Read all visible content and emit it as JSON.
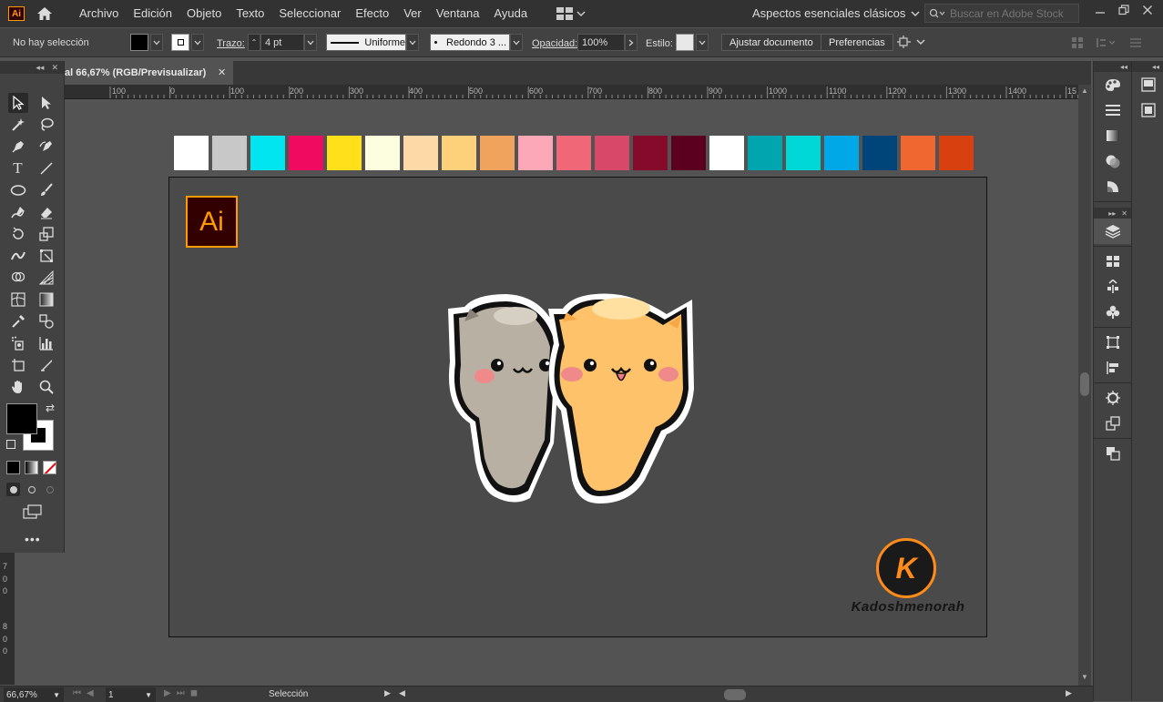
{
  "app": {
    "logo": "Ai"
  },
  "menu": [
    "Archivo",
    "Edición",
    "Objeto",
    "Texto",
    "Seleccionar",
    "Efecto",
    "Ver",
    "Ventana",
    "Ayuda"
  ],
  "workspace": "Aspectos esenciales clásicos",
  "stock_search": {
    "placeholder": "Buscar en Adobe Stock"
  },
  "control": {
    "selection": "No hay selección",
    "stroke_label": "Trazo:",
    "stroke_value": "4 pt",
    "profile": "Uniforme",
    "brush": "Redondo 3 ...",
    "opacity_label": "Opacidad:",
    "opacity_value": "100%",
    "style_label": "Estilo:",
    "fit_doc_button": "Ajustar documento",
    "preferences_button": "Preferencias"
  },
  "document": {
    "tab_title": "al 66,67% (RGB/Previsualizar)"
  },
  "ruler": [
    "100",
    "0",
    "100",
    "200",
    "300",
    "400",
    "500",
    "600",
    "700",
    "800",
    "900",
    "1000",
    "1100",
    "1200",
    "1300",
    "1400",
    "15"
  ],
  "vruler": [
    "7",
    "0",
    "0",
    "8",
    "0",
    "0"
  ],
  "swatch_colors": [
    "#ffffff",
    "#c8c8c8",
    "#00e5f0",
    "#f00a60",
    "#ffe01a",
    "#fdfde0",
    "#fdd9a8",
    "#fdd07a",
    "#f0a35c",
    "#fca8b8",
    "#f06878",
    "#d84868",
    "#860a2c",
    "#5c0020",
    "#ffffff",
    "#00a5b0",
    "#00d8d8",
    "#00a8e8",
    "#00457a",
    "#f06830",
    "#d84010"
  ],
  "artboard": {
    "badge": "Ai",
    "brand_letter": "K",
    "brand_name": "Kadoshmenorah"
  },
  "status": {
    "zoom": "66,67%",
    "page": "1",
    "tool": "Selección"
  }
}
